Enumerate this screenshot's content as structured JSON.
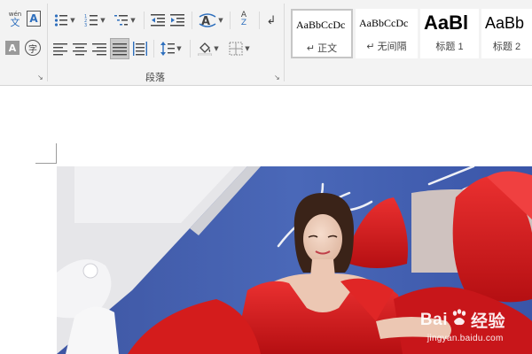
{
  "ribbon": {
    "font_group": {
      "phonetic_guide_label": "wén",
      "phonetic_guide_glyph": "文",
      "char_border_glyph": "A",
      "char_shading_glyph": "A",
      "enclose_char_glyph": "字"
    },
    "paragraph_group": {
      "label": "段落",
      "sort_glyph_top": "A",
      "sort_glyph_bottom": "Z"
    },
    "styles_group": {
      "styles": [
        {
          "sample": "AaBbCcDc",
          "name": "↵ 正文",
          "selected": true
        },
        {
          "sample": "AaBbCcDc",
          "name": "↵ 无间隔",
          "selected": false
        },
        {
          "sample": "AaBl",
          "name": "标题 1",
          "selected": false
        },
        {
          "sample": "AaBb",
          "name": "标题 2",
          "selected": false
        }
      ]
    }
  },
  "document": {
    "image": {
      "watermark_brand": "Bai",
      "watermark_brand_2": "经验",
      "watermark_url": "jingyan.baidu.com"
    }
  },
  "colors": {
    "ribbon_bg": "#f3f3f3",
    "icon_blue": "#2e6fbd",
    "wall_blue": "#3f5aa8",
    "dress_red": "#d81e1e"
  }
}
